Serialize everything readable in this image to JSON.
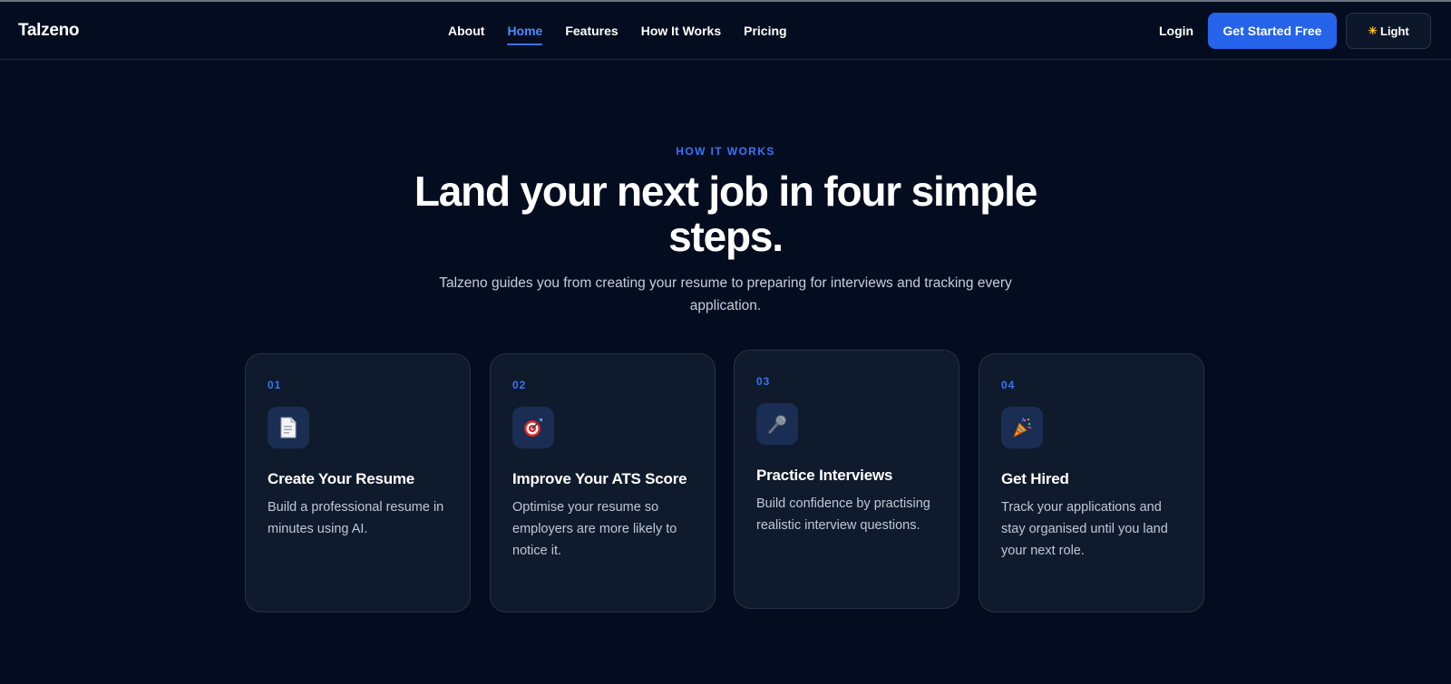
{
  "brand": {
    "name": "Talzeno"
  },
  "nav": {
    "links": [
      {
        "label": "About",
        "active": false
      },
      {
        "label": "Home",
        "active": true
      },
      {
        "label": "Features",
        "active": false
      },
      {
        "label": "How It Works",
        "active": false
      },
      {
        "label": "Pricing",
        "active": false
      }
    ],
    "login_label": "Login",
    "cta_label": "Get Started Free",
    "theme_label": "Light",
    "theme_icon": "sun-icon"
  },
  "hero": {
    "eyebrow": "HOW IT WORKS",
    "title": "Land your next job in four simple steps.",
    "subtitle": "Talzeno guides you from creating your resume to preparing for interviews and tracking every application."
  },
  "steps": [
    {
      "number": "01",
      "icon": "document-icon",
      "title": "Create Your Resume",
      "description": "Build a professional resume in minutes using AI."
    },
    {
      "number": "02",
      "icon": "target-icon",
      "title": "Improve Your ATS Score",
      "description": "Optimise your resume so employers are more likely to notice it."
    },
    {
      "number": "03",
      "icon": "microphone-icon",
      "title": "Practice Interviews",
      "description": "Build confidence by practising realistic interview questions."
    },
    {
      "number": "04",
      "icon": "party-popper-icon",
      "title": "Get Hired",
      "description": "Track your applications and stay organised until you land your next role."
    }
  ],
  "colors": {
    "background": "#030d1f",
    "accent": "#2563eb",
    "accent_text": "#3b74f5",
    "card_background": "#0f1a2c",
    "card_border": "#26324a",
    "icon_tile": "#1a2d52"
  }
}
